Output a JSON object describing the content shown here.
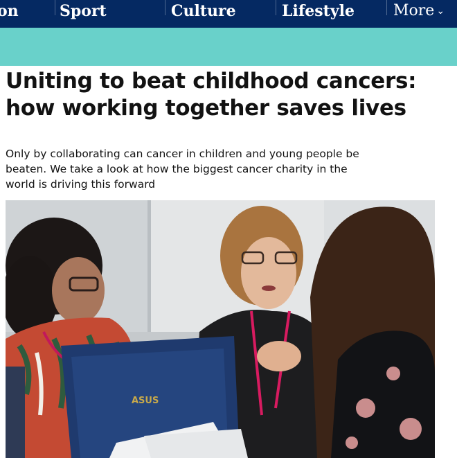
{
  "nav": {
    "items": [
      {
        "label": "on"
      },
      {
        "label": "Sport"
      },
      {
        "label": "Culture"
      },
      {
        "label": "Lifestyle"
      },
      {
        "label": "More"
      }
    ]
  },
  "article": {
    "headline": "Uniting to beat childhood cancers: how working together saves lives",
    "standfirst": "Only by collaborating can cancer in children and young people be beaten. We take a look at how the biggest cancer charity in the world is driving this forward",
    "image_laptop_brand": "ASUS"
  },
  "colors": {
    "nav_background": "#052962",
    "accent_band": "#69d1ca",
    "text": "#121212"
  },
  "icons": {
    "more_chevron": "chevron-down-icon"
  }
}
